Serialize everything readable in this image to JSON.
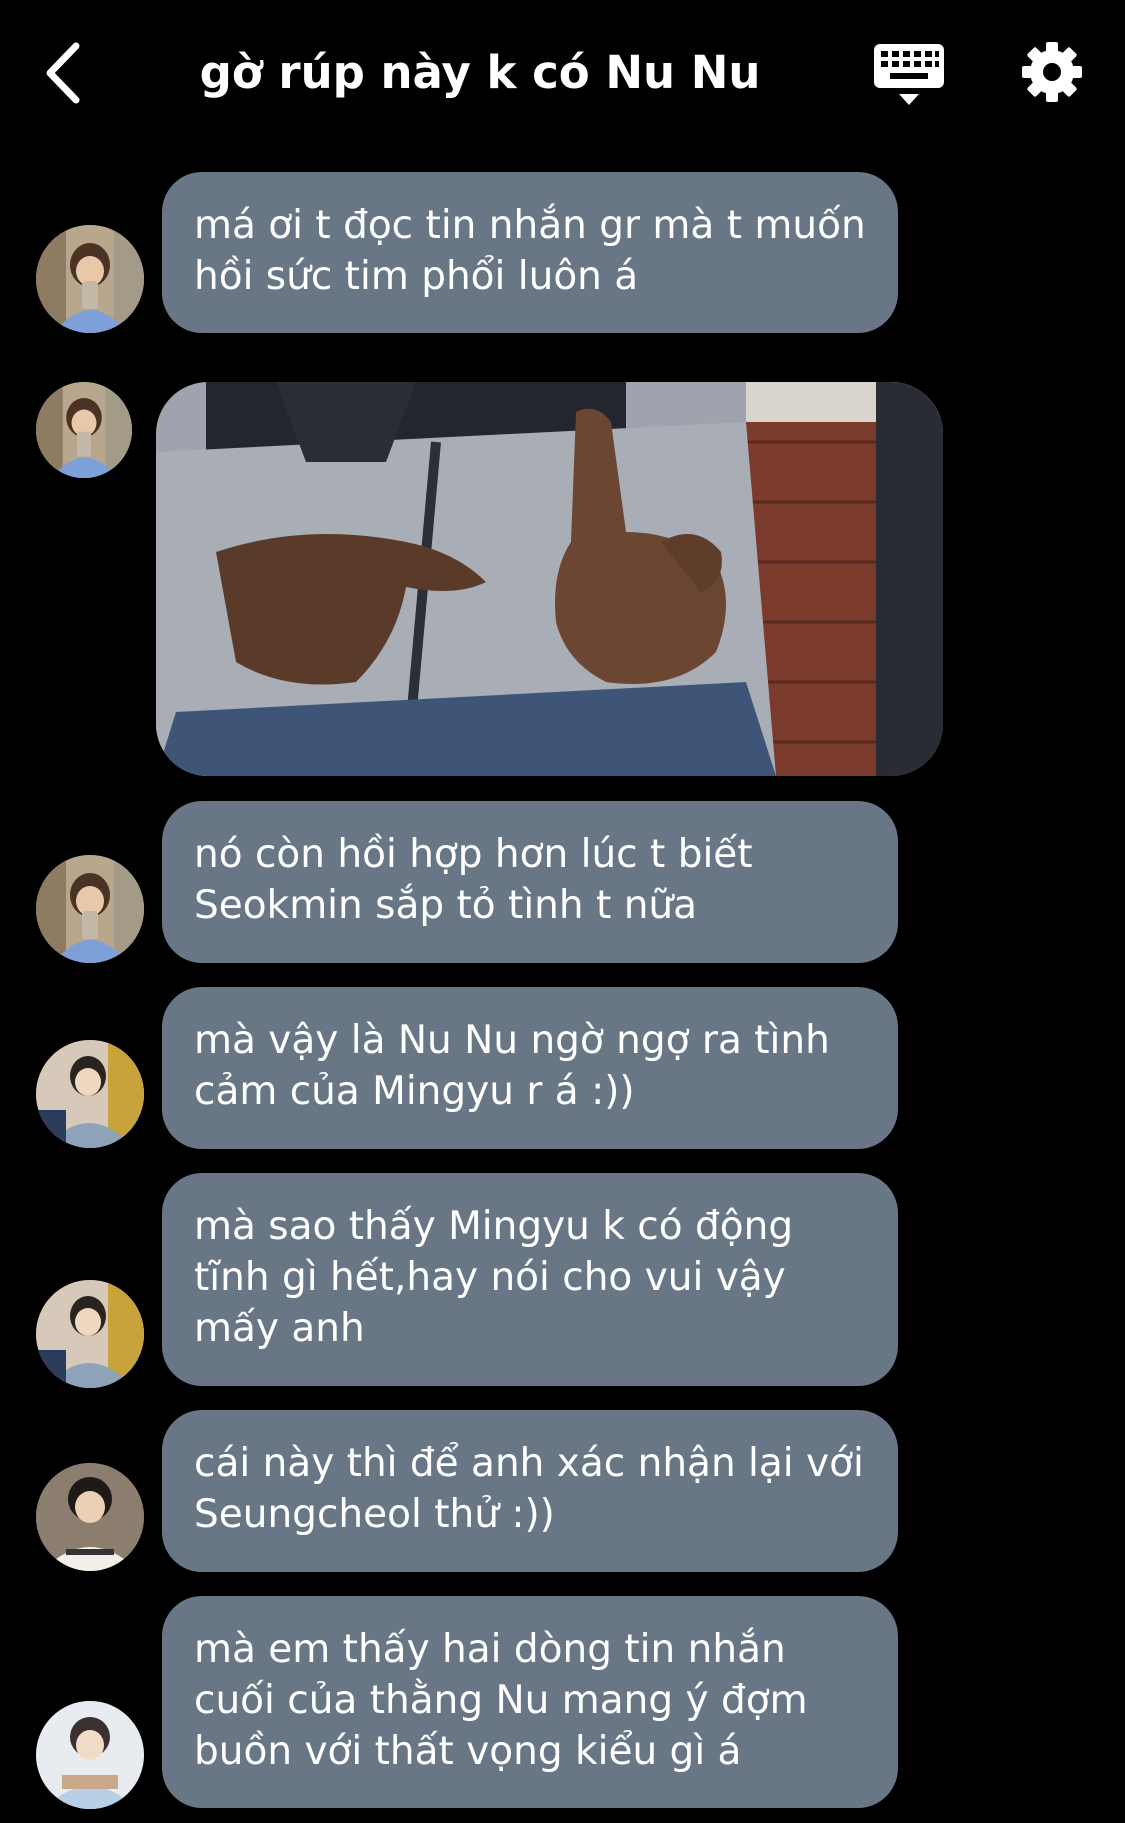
{
  "header": {
    "title": "gờ rúp này k có Nu Nu",
    "back_icon": "chevron-left-icon",
    "keyboard_icon": "keyboard-icon",
    "settings_icon": "gear-icon"
  },
  "messages": [
    {
      "type": "text",
      "text": "má ơi t đọc tin nhắn gr mà t muốn\nhồi sức tim phổi luôn á",
      "avatar": "avatar-1"
    },
    {
      "type": "image",
      "avatar": "avatar-1",
      "image": "photo-person-hand-gesture"
    },
    {
      "type": "text",
      "text": "nó còn hồi hợp hơn lúc t biết\nSeokmin sắp tỏ tình t nữa",
      "avatar": "avatar-1"
    },
    {
      "type": "text",
      "text": "mà vậy là Nu Nu ngờ ngợ ra tình\ncảm của Mingyu r á :))",
      "avatar": "avatar-2"
    },
    {
      "type": "text",
      "text": "mà sao thấy Mingyu k có động\ntĩnh gì hết,hay nói cho vui vậy\nmấy anh",
      "avatar": "avatar-2"
    },
    {
      "type": "text",
      "text": "cái này thì để anh xác nhận lại với\nSeungcheol thử :))",
      "avatar": "avatar-3"
    },
    {
      "type": "text",
      "text": "mà em thấy hai dòng tin nhắn\ncuối của thằng Nu  mang ý đợm\nbuồn với thất vọng kiểu gì á",
      "avatar": "avatar-4"
    }
  ],
  "colors": {
    "background": "#000000",
    "bubble": "#687685",
    "text": "#ffffff"
  }
}
